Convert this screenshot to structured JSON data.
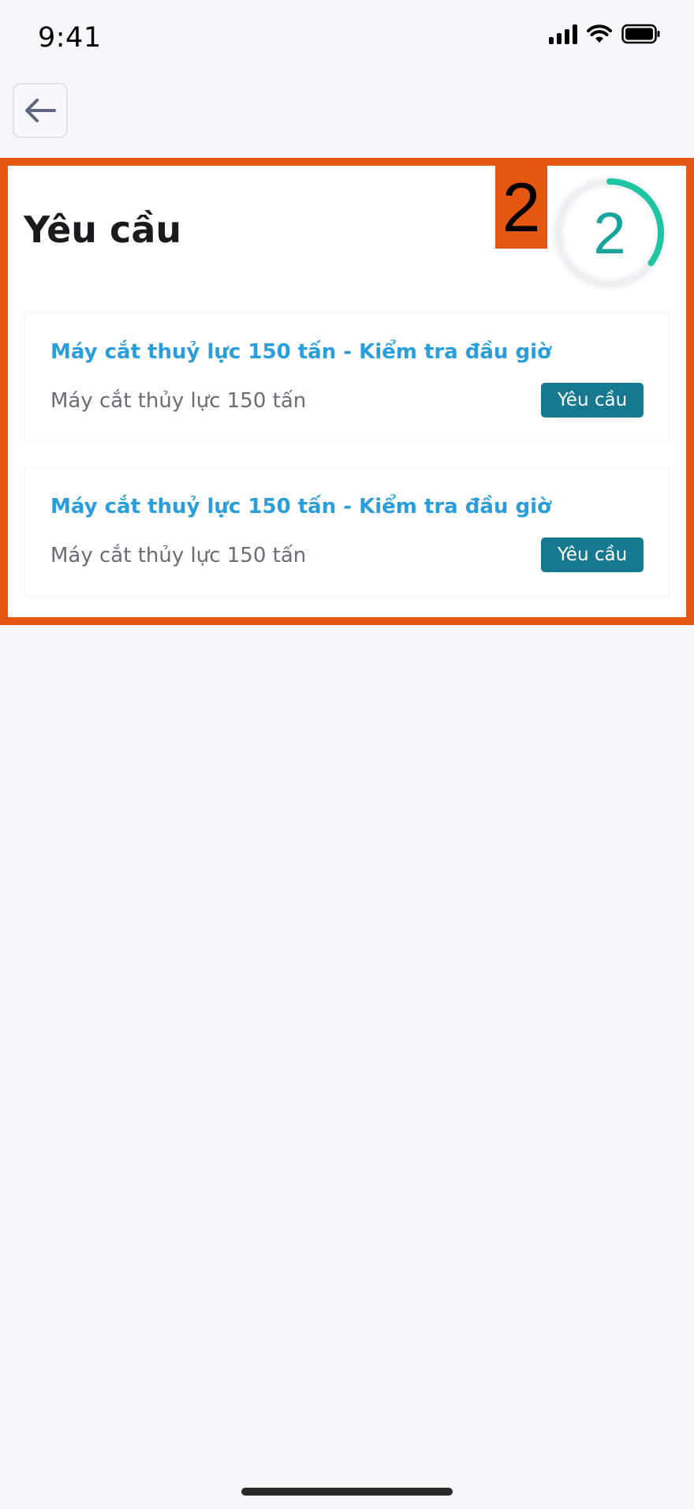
{
  "status_bar": {
    "time": "9:41"
  },
  "header": {
    "back_icon": "arrow-left-icon"
  },
  "annotation": {
    "marker": "2",
    "color": "#e4570f"
  },
  "page": {
    "title": "Yêu cầu"
  },
  "progress": {
    "count": "2",
    "fraction": 0.35,
    "color": "#1fc4a3"
  },
  "requests": [
    {
      "title": "Máy cắt thuỷ lực 150 tấn - Kiểm tra đầu giờ",
      "subtitle": "Máy cắt thủy lực 150 tấn",
      "button_label": "Yêu cầu"
    },
    {
      "title": "Máy cắt thuỷ lực 150 tấn - Kiểm tra đầu giờ",
      "subtitle": "Máy cắt thủy lực 150 tấn",
      "button_label": "Yêu cầu"
    }
  ],
  "colors": {
    "title_link": "#2a9ddb",
    "button": "#17798f",
    "background": "#f7f7fb"
  }
}
